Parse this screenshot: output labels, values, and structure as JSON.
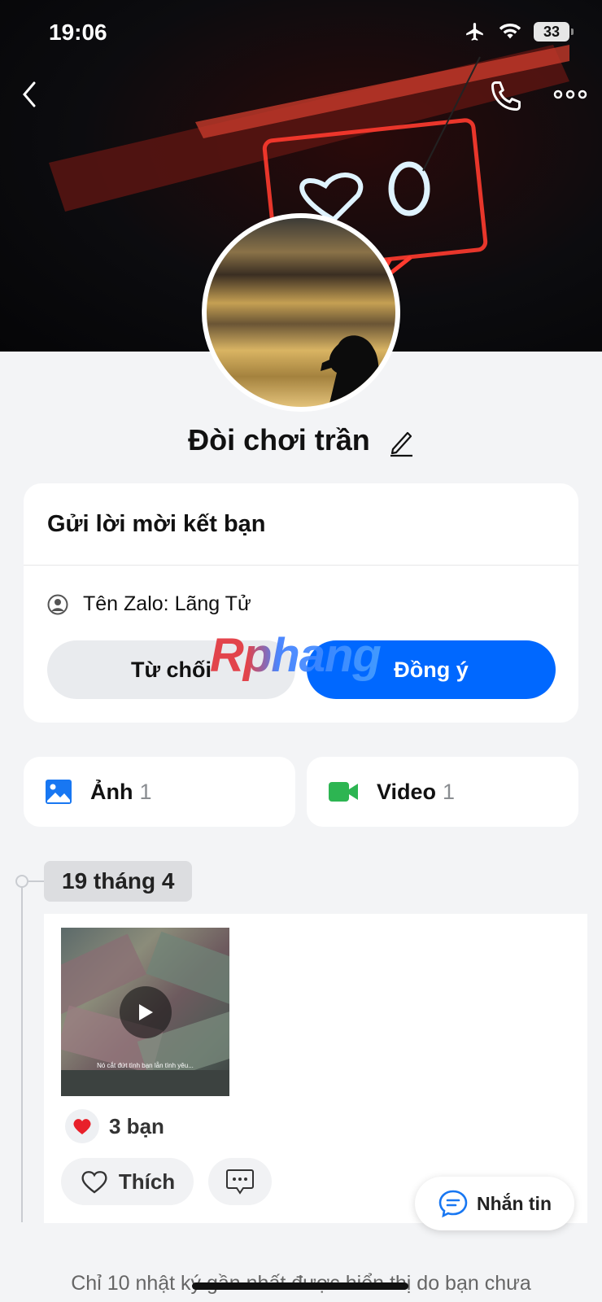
{
  "status_bar": {
    "time": "19:06",
    "battery": "33",
    "icons": [
      "airplane-icon",
      "wifi-icon",
      "battery-icon"
    ]
  },
  "header": {
    "icons": [
      "back-icon",
      "phone-icon",
      "more-icon"
    ]
  },
  "profile": {
    "name": "Đòi chơi trần"
  },
  "friend_request": {
    "title": "Gửi lời mời kết bạn",
    "zalo_label": "Tên Zalo: ",
    "zalo_name": "Lãng Tử",
    "reject_label": "Từ chối",
    "accept_label": "Đồng ý"
  },
  "watermark": "Rphang",
  "media": {
    "photo_label": "Ảnh",
    "photo_count": "1",
    "video_label": "Video",
    "video_count": "1"
  },
  "timeline": {
    "date": "19 tháng 4",
    "post": {
      "video_caption": "Nó cắt đứt tình bạn lẫn tình yêu...",
      "reaction_count": "3 bạn",
      "like_label": "Thích"
    }
  },
  "message_button": {
    "label": "Nhắn tin"
  },
  "footer_note": "Chỉ 10 nhật ký gần nhất được hiển thị do bạn chưa",
  "colors": {
    "accent": "#0068ff",
    "video_icon": "#2db552",
    "heart": "#e8202a"
  }
}
